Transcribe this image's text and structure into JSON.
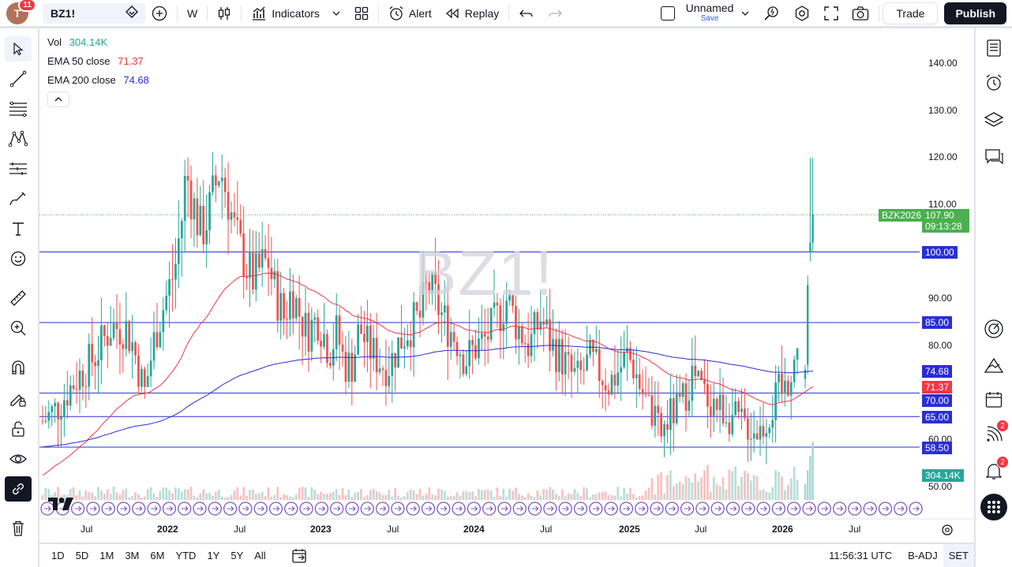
{
  "topbar": {
    "avatar_letter": "T",
    "notification_count": "11",
    "symbol": "BZ1!",
    "interval": "W",
    "indicators_label": "Indicators",
    "alert_label": "Alert",
    "replay_label": "Replay",
    "layout_name": "Unnamed",
    "layout_save": "Save",
    "trade_label": "Trade",
    "publish_label": "Publish"
  },
  "legend": {
    "vol_label": "Vol",
    "vol_value": "304.14K",
    "ema50_label": "EMA 50 close",
    "ema50_value": "71.37",
    "ema200_label": "EMA 200 close",
    "ema200_value": "74.68"
  },
  "watermark": "BZ1!",
  "price_axis": {
    "ticks": [
      "140.00",
      "130.00",
      "120.00",
      "110.00",
      "90.00",
      "80.00",
      "60.00",
      "50.00"
    ],
    "tick_values": [
      140,
      130,
      120,
      110,
      90,
      80,
      60,
      50
    ]
  },
  "price_tags": {
    "contract_label": "BZK2026",
    "last_price": "107.90",
    "countdown": "09:13:28",
    "level_100": "100.00",
    "level_85": "85.00",
    "ema200": "74.68",
    "ema50": "71.37",
    "level_70": "70.00",
    "level_65": "65.00",
    "level_58": "58.50",
    "volume": "304.14K"
  },
  "time_axis": {
    "labels": [
      "Jul",
      "2022",
      "Jul",
      "2023",
      "Jul",
      "2024",
      "Jul",
      "2025",
      "Jul",
      "2026",
      "Jul"
    ]
  },
  "bottombar": {
    "ranges": [
      "1D",
      "5D",
      "1M",
      "3M",
      "6M",
      "YTD",
      "1Y",
      "5Y",
      "All"
    ],
    "clock": "11:56:31 UTC",
    "adj": "B-ADJ",
    "session": "SET"
  },
  "right_toolbar": {
    "ideas_badge": "2",
    "notifications_badge": "2"
  },
  "colors": {
    "up": "#26a69a",
    "down": "#ef5350",
    "ema50": "#f23645",
    "ema200": "#2b2bd6",
    "hline": "#2a2fd4",
    "last_price": "#4caf50"
  },
  "chart_data": {
    "type": "candlestick",
    "ylim": [
      50,
      143
    ],
    "horizontal_levels": [
      100,
      85,
      70,
      65,
      58.5
    ],
    "last_price": 107.9,
    "ema50_last": 71.37,
    "ema200_last": 74.68,
    "price_path": [
      [
        0,
        64
      ],
      [
        0.02,
        67
      ],
      [
        0.04,
        72
      ],
      [
        0.07,
        78
      ],
      [
        0.09,
        84
      ],
      [
        0.11,
        84
      ],
      [
        0.12,
        80
      ],
      [
        0.135,
        70
      ],
      [
        0.15,
        83
      ],
      [
        0.165,
        91
      ],
      [
        0.175,
        96
      ],
      [
        0.185,
        108
      ],
      [
        0.19,
        117
      ],
      [
        0.2,
        110
      ],
      [
        0.21,
        104
      ],
      [
        0.22,
        108
      ],
      [
        0.235,
        118
      ],
      [
        0.245,
        112
      ],
      [
        0.255,
        104
      ],
      [
        0.27,
        97
      ],
      [
        0.28,
        94
      ],
      [
        0.29,
        97
      ],
      [
        0.3,
        98
      ],
      [
        0.305,
        93
      ],
      [
        0.32,
        86
      ],
      [
        0.33,
        92
      ],
      [
        0.34,
        87
      ],
      [
        0.35,
        83
      ],
      [
        0.365,
        86
      ],
      [
        0.38,
        79
      ],
      [
        0.39,
        83
      ],
      [
        0.4,
        76
      ],
      [
        0.41,
        76
      ],
      [
        0.42,
        84
      ],
      [
        0.43,
        80
      ],
      [
        0.44,
        78
      ],
      [
        0.45,
        76
      ],
      [
        0.46,
        76
      ],
      [
        0.47,
        80
      ],
      [
        0.485,
        84
      ],
      [
        0.5,
        86
      ],
      [
        0.51,
        93
      ],
      [
        0.52,
        90
      ],
      [
        0.53,
        86
      ],
      [
        0.55,
        81
      ],
      [
        0.56,
        77
      ],
      [
        0.575,
        80
      ],
      [
        0.585,
        81
      ],
      [
        0.6,
        85
      ],
      [
        0.615,
        90
      ],
      [
        0.63,
        84
      ],
      [
        0.645,
        80
      ],
      [
        0.66,
        86
      ],
      [
        0.675,
        80
      ],
      [
        0.69,
        77
      ],
      [
        0.7,
        74
      ],
      [
        0.71,
        73
      ],
      [
        0.725,
        77
      ],
      [
        0.74,
        74
      ],
      [
        0.75,
        72
      ],
      [
        0.76,
        74
      ],
      [
        0.775,
        78
      ],
      [
        0.785,
        75
      ],
      [
        0.79,
        72
      ],
      [
        0.8,
        68
      ],
      [
        0.81,
        64
      ],
      [
        0.82,
        61
      ],
      [
        0.83,
        65
      ],
      [
        0.845,
        67
      ],
      [
        0.86,
        74
      ],
      [
        0.875,
        70
      ],
      [
        0.89,
        68
      ],
      [
        0.905,
        66
      ],
      [
        0.92,
        64
      ],
      [
        0.935,
        63
      ],
      [
        0.95,
        62
      ],
      [
        0.965,
        66
      ],
      [
        0.975,
        70
      ],
      [
        0.985,
        71
      ],
      [
        0.992,
        76
      ],
      [
        1.0,
        78
      ]
    ],
    "final_candles": [
      {
        "o": 73,
        "h": 76,
        "l": 71,
        "c": 75
      },
      {
        "o": 76,
        "h": 95,
        "l": 74,
        "c": 93
      },
      {
        "o": 100,
        "h": 120,
        "l": 98,
        "c": 102
      },
      {
        "o": 102,
        "h": 120,
        "l": 100,
        "c": 108
      }
    ]
  }
}
